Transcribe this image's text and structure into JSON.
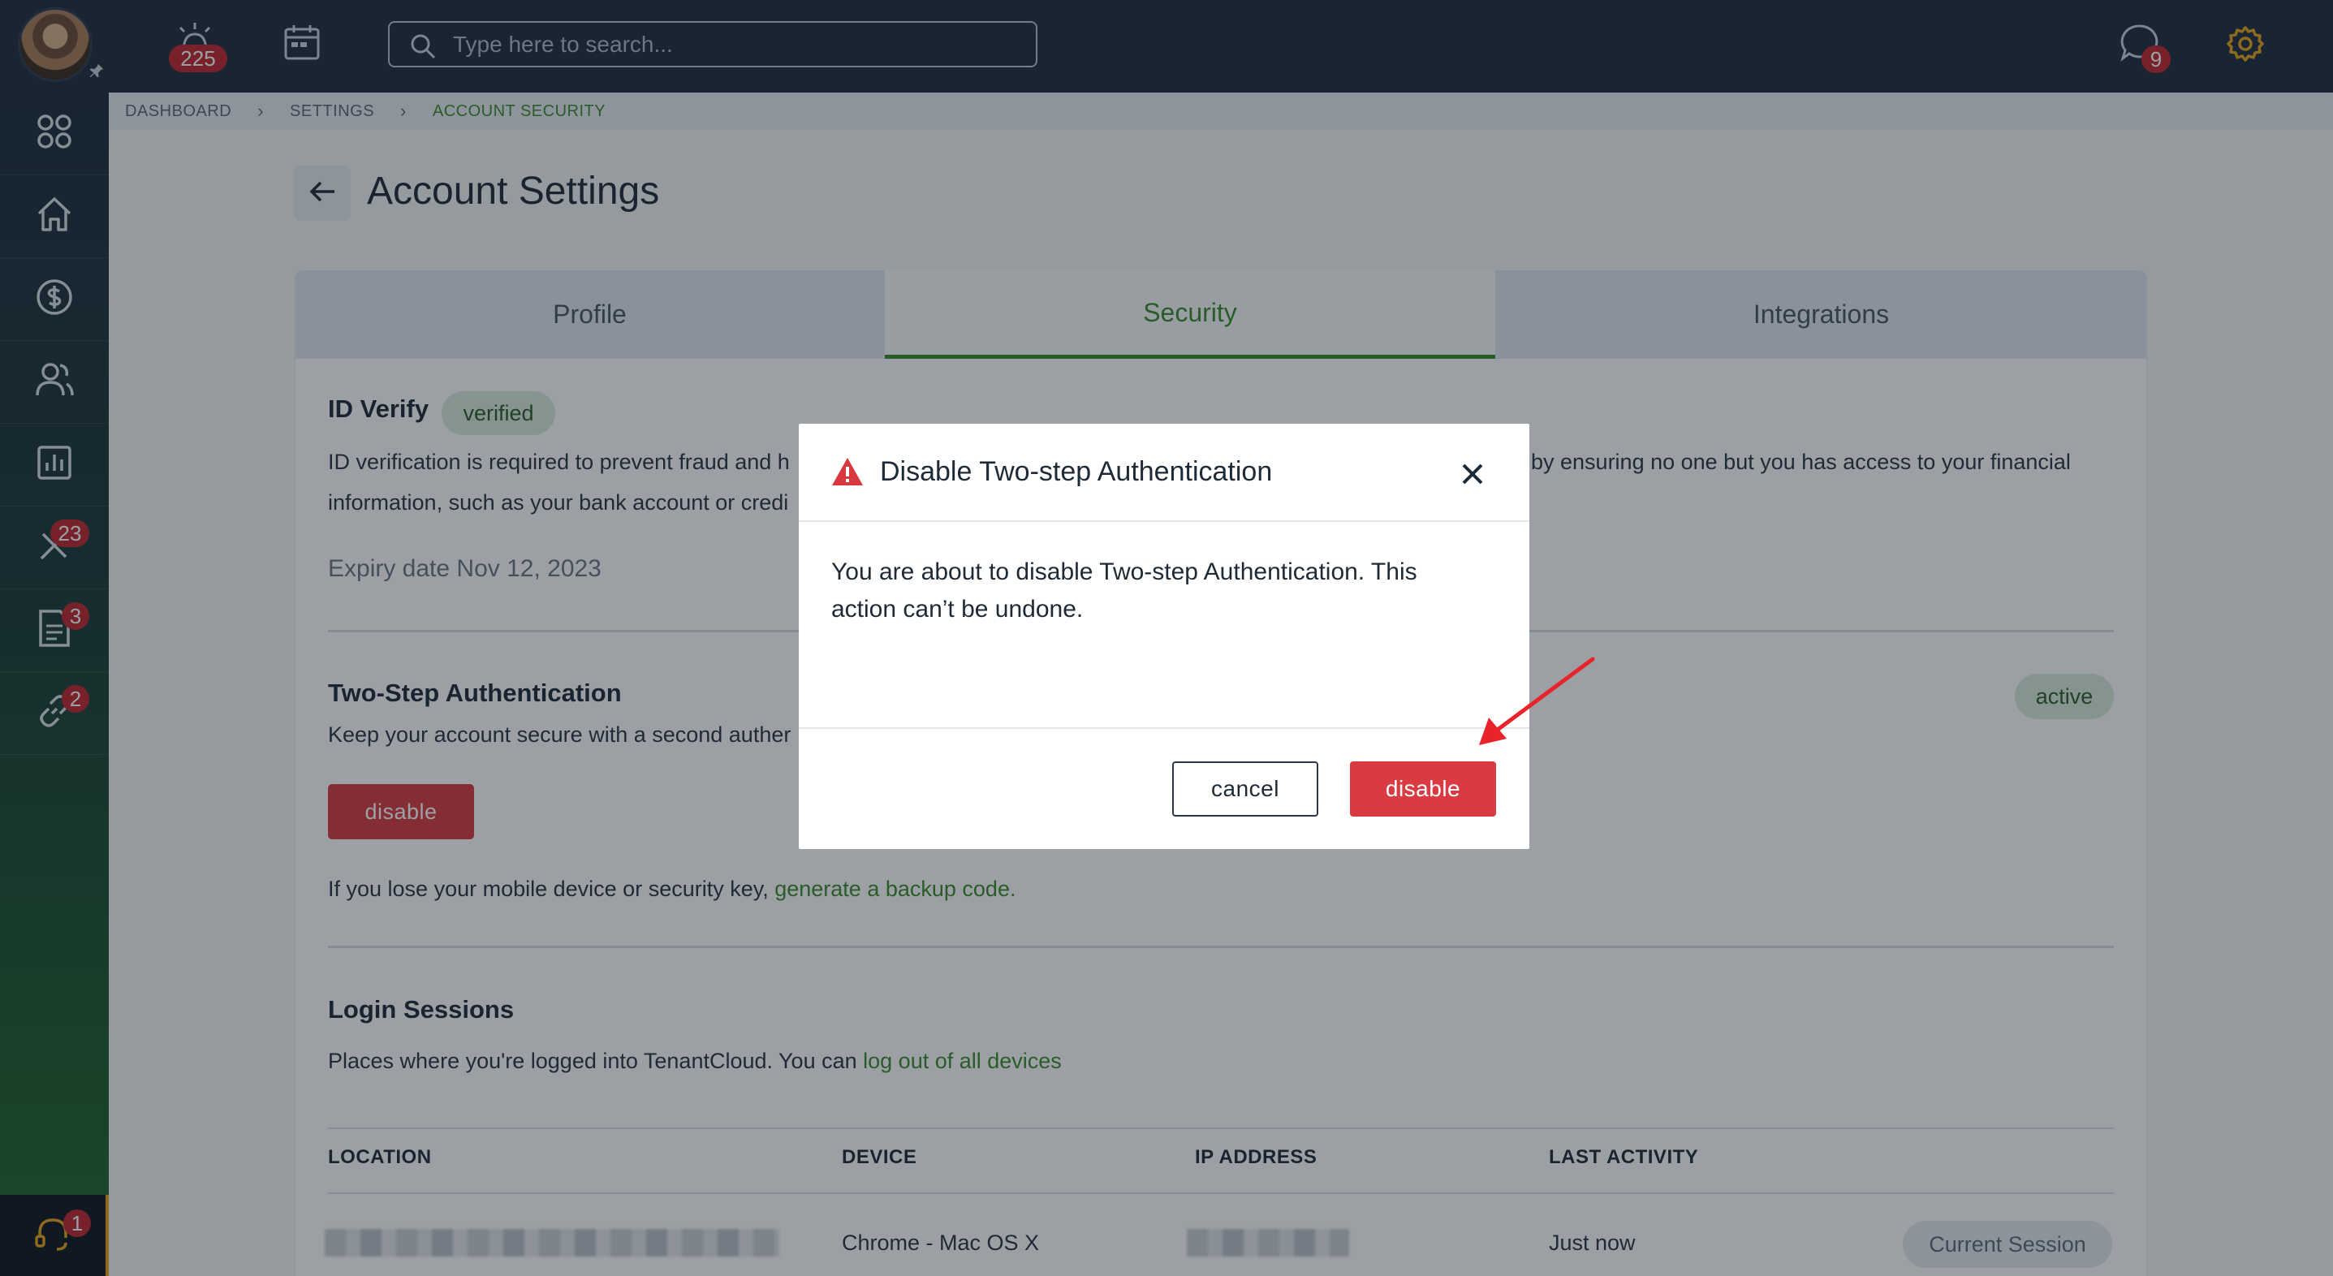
{
  "topbar": {
    "notifications_count": "225",
    "search_placeholder": "Type here to search...",
    "messages_count": "9"
  },
  "sidebar": {
    "items": [
      {
        "icon": "apps-grid-icon"
      },
      {
        "icon": "home-icon"
      },
      {
        "icon": "dollar-icon"
      },
      {
        "icon": "users-icon"
      },
      {
        "icon": "reports-icon"
      },
      {
        "icon": "tools-icon",
        "badge": "23"
      },
      {
        "icon": "documents-icon",
        "badge": "3"
      },
      {
        "icon": "link-icon",
        "badge": "2"
      }
    ],
    "support_badge": "1"
  },
  "breadcrumb": {
    "items": [
      "DASHBOARD",
      "SETTINGS",
      "ACCOUNT SECURITY"
    ]
  },
  "page": {
    "title": "Account Settings"
  },
  "tabs": [
    {
      "label": "Profile",
      "active": false
    },
    {
      "label": "Security",
      "active": true
    },
    {
      "label": "Integrations",
      "active": false
    }
  ],
  "id_verify": {
    "title": "ID Verify",
    "status": "verified",
    "line1_left": "ID verification is required to prevent fraud and h",
    "line1_right": "by ensuring no one but you has access to your financial",
    "line2": "information, such as your bank account or credi",
    "expiry": "Expiry date Nov 12, 2023"
  },
  "two_step": {
    "title": "Two-Step Authentication",
    "description": "Keep your account secure with a second auther",
    "status": "active",
    "disable_label": "disable",
    "backup_text": "If you lose your mobile device or security key, ",
    "backup_link": "generate a backup code."
  },
  "login_sessions": {
    "title": "Login Sessions",
    "text": "Places where you're logged into TenantCloud. You can ",
    "link": "log out of all devices",
    "columns": [
      "LOCATION",
      "DEVICE",
      "IP ADDRESS",
      "LAST ACTIVITY"
    ],
    "rows": [
      {
        "device": "Chrome - Mac OS X",
        "last_activity": "Just now",
        "badge": "Current Session"
      }
    ]
  },
  "modal": {
    "title": "Disable Two-step Authentication",
    "body": "You are about to disable Two-step Authentication. This action can’t be undone.",
    "cancel_label": "cancel",
    "confirm_label": "disable"
  },
  "colors": {
    "accent_green": "#3c8b2b",
    "danger_red": "#da3b42",
    "topbar_bg": "#1e2b3c",
    "settings_orange": "#e7a21c"
  }
}
